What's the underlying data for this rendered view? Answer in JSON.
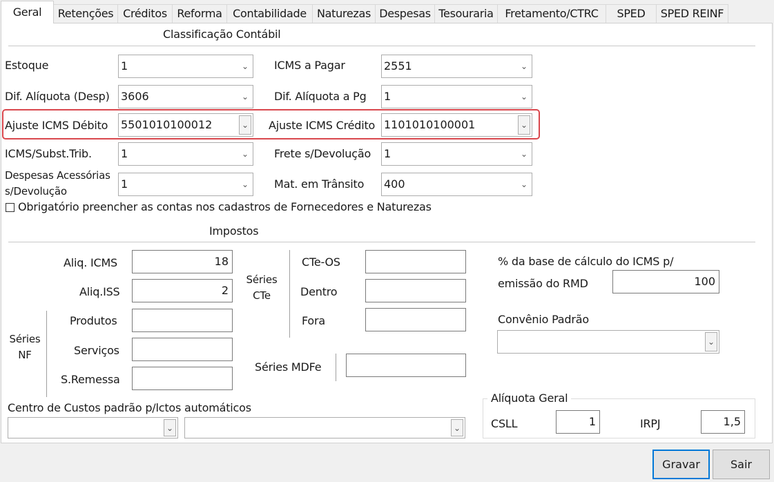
{
  "tabs": [
    "Geral",
    "Retenções",
    "Créditos",
    "Reforma",
    "Contabilidade",
    "Naturezas",
    "Despesas",
    "Tesouraria",
    "Fretamento/CTRC",
    "SPED",
    "SPED REINF"
  ],
  "classificacao": {
    "title": "Classificação Contábil",
    "estoque_label": "Estoque",
    "estoque_value": "1",
    "icms_pagar_label": "ICMS a Pagar",
    "icms_pagar_value": "2551",
    "dif_aliq_desp_label": "Dif. Alíquota (Desp)",
    "dif_aliq_desp_value": "3606",
    "dif_aliq_pg_label": "Dif. Alíquota a Pg",
    "dif_aliq_pg_value": "1",
    "ajuste_debito_label": "Ajuste ICMS Débito",
    "ajuste_debito_value": "5501010100012",
    "ajuste_credito_label": "Ajuste ICMS Crédito",
    "ajuste_credito_value": "1101010100001",
    "icms_subst_label": "ICMS/Subst.Trib.",
    "icms_subst_value": "1",
    "frete_devolucao_label": "Frete s/Devolução",
    "frete_devolucao_value": "1",
    "despesas_label": "Despesas Acessórias s/Devolução",
    "despesas_value": "1",
    "mat_transito_label": "Mat. em Trânsito",
    "mat_transito_value": "400",
    "obrigatorio_label": "Obrigatório preencher as contas nos cadastros de Fornecedores e Naturezas"
  },
  "impostos": {
    "title": "Impostos",
    "aliq_icms_label": "Aliq. ICMS",
    "aliq_icms_value": "18",
    "aliq_iss_label": "Aliq.ISS",
    "aliq_iss_value": "2",
    "series_nf_label": "Séries NF",
    "produtos_label": "Produtos",
    "produtos_value": "",
    "servicos_label": "Serviços",
    "servicos_value": "",
    "sremessa_label": "S.Remessa",
    "sremessa_value": "",
    "series_cte_label": "Séries CTe",
    "cte_os_label": "CTe-OS",
    "cte_os_value": "",
    "dentro_label": "Dentro",
    "dentro_value": "",
    "fora_label": "Fora",
    "fora_value": "",
    "series_mdfe_label": "Séries MDFe",
    "series_mdfe_value": "",
    "rmd_label_1": "% da base de cálculo do ICMS p/",
    "rmd_label_2": "emissão do RMD",
    "rmd_value": "100",
    "convenio_label": "Convênio Padrão",
    "convenio_value": ""
  },
  "centro_custos": {
    "label": "Centro de Custos padrão p/lctos automáticos",
    "value1": "",
    "value2": ""
  },
  "aliquota_geral": {
    "title": "Alíquota Geral",
    "csll_label": "CSLL",
    "csll_value": "1",
    "irpj_label": "IRPJ",
    "irpj_value": "1,5"
  },
  "buttons": {
    "gravar": "Gravar",
    "sair": "Sair"
  },
  "icons": {
    "dropdown": "chevron-down-icon"
  }
}
